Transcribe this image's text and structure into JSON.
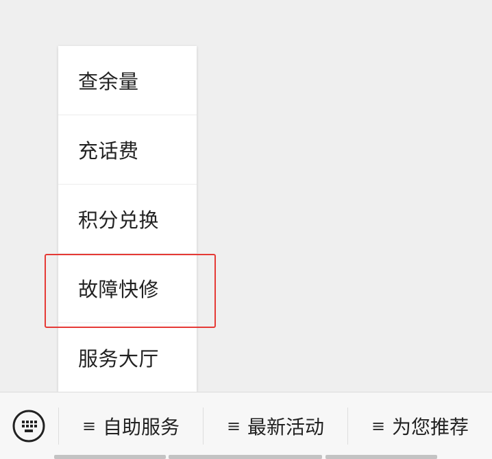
{
  "popup_menu": {
    "items": [
      {
        "label": "查余量"
      },
      {
        "label": "充话费"
      },
      {
        "label": "积分兑换"
      },
      {
        "label": "故障快修"
      },
      {
        "label": "服务大厅"
      }
    ]
  },
  "bottom_bar": {
    "keyboard_icon": "keyboard-icon",
    "tabs": [
      {
        "glyph": "≡",
        "label": "自助服务"
      },
      {
        "glyph": "≡",
        "label": "最新活动"
      },
      {
        "glyph": "≡",
        "label": "为您推荐"
      }
    ]
  },
  "colors": {
    "highlight": "#e53935",
    "background": "#efefef",
    "menu_bg": "#ffffff"
  }
}
